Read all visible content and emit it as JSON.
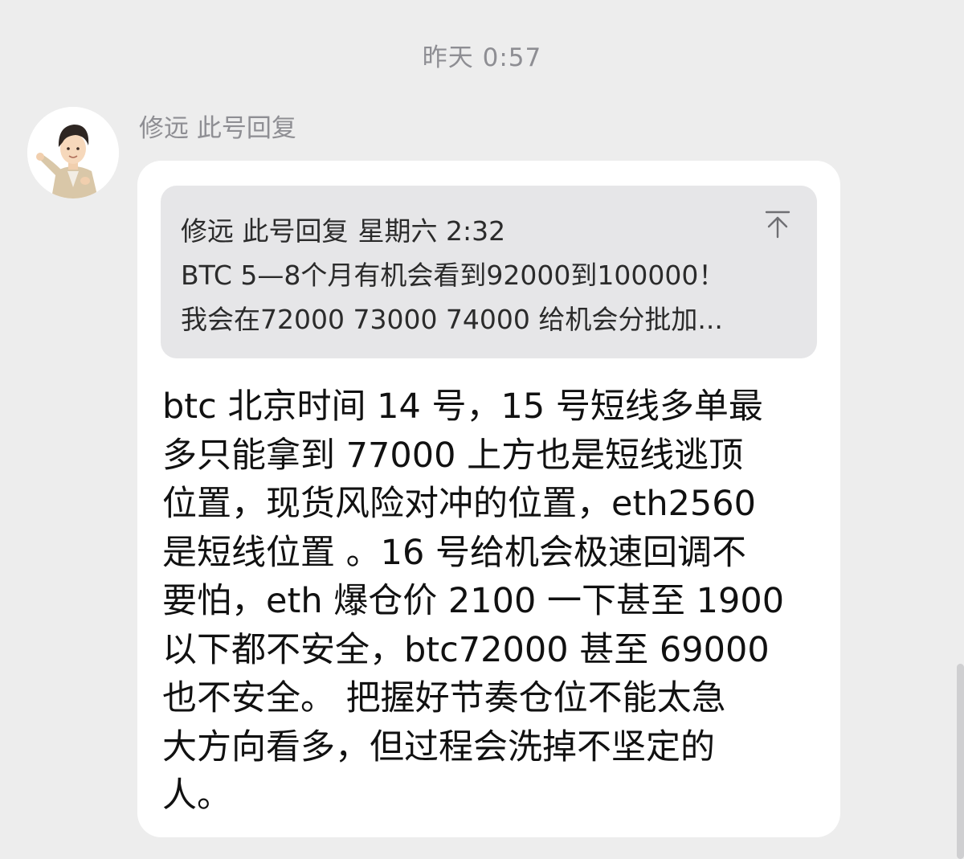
{
  "chat": {
    "timestamp": "昨天 0:57"
  },
  "message": {
    "sender_name": "修远 此号回复",
    "quote": {
      "author": "修远 此号回复",
      "time": "星期六 2:32",
      "lines": [
        "BTC 5—8个月有机会看到92000到100000！",
        "我会在72000 73000 74000 给机会分批加..."
      ],
      "icon": "pin-to-top-icon"
    },
    "body_lines": [
      "btc 北京时间 14 号，15 号短线多单最",
      "多只能拿到 77000 上方也是短线逃顶",
      "位置，现货风险对冲的位置，eth2560",
      "是短线位置 。16 号给机会极速回调不",
      "要怕，eth 爆仓价 2100 一下甚至 1900",
      "以下都不安全，btc72000 甚至 69000",
      "也不安全。 把握好节奏仓位不能太急",
      "大方向看多，但过程会洗掉不坚定的",
      "人。"
    ]
  },
  "colors": {
    "background": "#ededed",
    "bubble": "#ffffff",
    "quote_background": "#e6e6e8",
    "secondary_text": "#8e8e93"
  }
}
